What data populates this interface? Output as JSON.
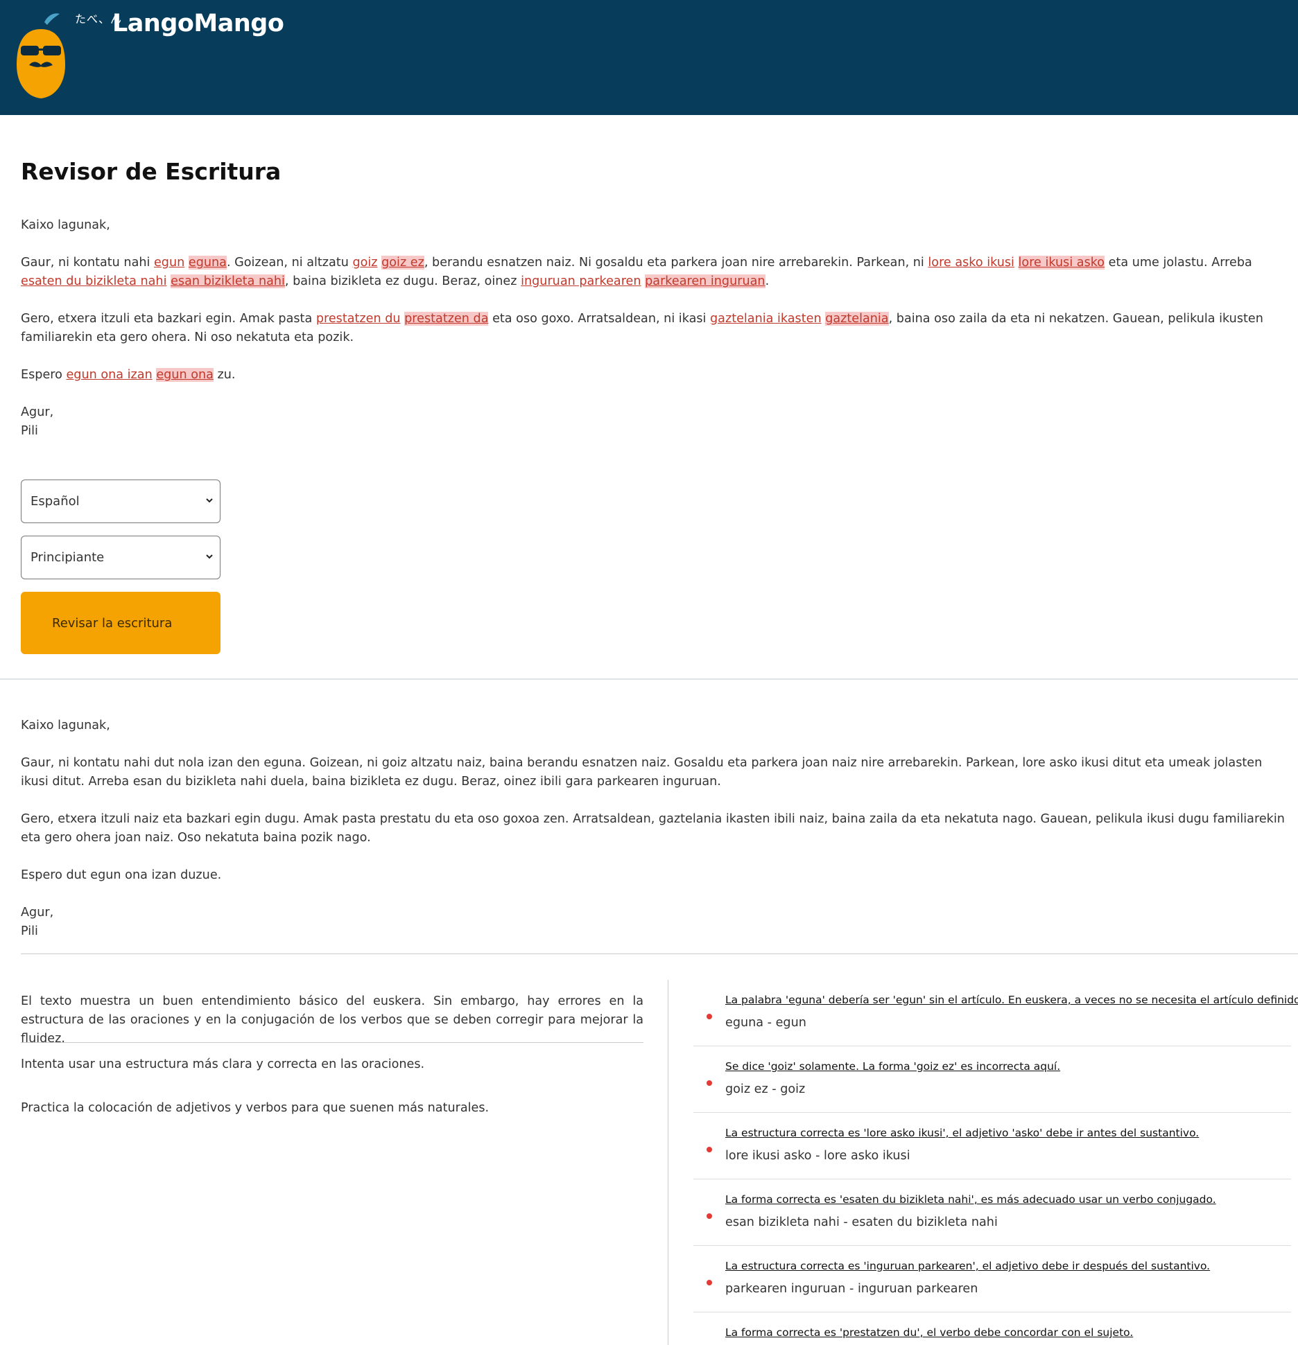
{
  "header": {
    "kanji": "たべ、ん",
    "brand": "LangoMango",
    "colors": {
      "background": "#073c5a",
      "mango": "#f5a203"
    }
  },
  "page_title": "Revisor de Escritura",
  "original_text": {
    "greeting": "Kaixo lagunak,",
    "p1": [
      {
        "t": "Gaur, ni kontatu nahi ",
        "s": "n"
      },
      {
        "t": "egun",
        "s": "e"
      },
      {
        "t": " ",
        "s": "n"
      },
      {
        "t": "eguna",
        "s": "h"
      },
      {
        "t": ". Goizean, ni altzatu ",
        "s": "n"
      },
      {
        "t": "goiz",
        "s": "e"
      },
      {
        "t": " ",
        "s": "n"
      },
      {
        "t": "goiz ez",
        "s": "h"
      },
      {
        "t": ", berandu esnatzen naiz. Ni gosaldu eta parkera joan nire arrebarekin. Parkean, ni ",
        "s": "n"
      },
      {
        "t": "lore asko ikusi",
        "s": "e"
      },
      {
        "t": " ",
        "s": "n"
      },
      {
        "t": "lore ikusi asko",
        "s": "h"
      },
      {
        "t": " eta ume jolastu. Arreba ",
        "s": "n"
      },
      {
        "t": "esaten du bizikleta nahi",
        "s": "e"
      },
      {
        "t": " ",
        "s": "n"
      },
      {
        "t": "esan bizikleta nahi",
        "s": "h"
      },
      {
        "t": ", baina bizikleta ez dugu. Beraz, oinez ",
        "s": "n"
      },
      {
        "t": "inguruan parkearen",
        "s": "e"
      },
      {
        "t": " ",
        "s": "n"
      },
      {
        "t": "parkearen inguruan",
        "s": "h"
      },
      {
        "t": ".",
        "s": "n"
      }
    ],
    "p2": [
      {
        "t": "Gero, etxera itzuli eta bazkari egin. Amak pasta ",
        "s": "n"
      },
      {
        "t": "prestatzen du",
        "s": "e"
      },
      {
        "t": " ",
        "s": "n"
      },
      {
        "t": "prestatzen da",
        "s": "h"
      },
      {
        "t": " eta oso goxo. Arratsaldean, ni ikasi ",
        "s": "n"
      },
      {
        "t": "gaztelania ikasten",
        "s": "e"
      },
      {
        "t": " ",
        "s": "n"
      },
      {
        "t": "gaztelania",
        "s": "h"
      },
      {
        "t": ", baina oso zaila da eta ni nekatzen. Gauean, pelikula ikusten familiarekin eta gero ohera. Ni oso nekatuta eta pozik.",
        "s": "n"
      }
    ],
    "p3": [
      {
        "t": "Espero ",
        "s": "n"
      },
      {
        "t": "egun ona izan",
        "s": "e"
      },
      {
        "t": " ",
        "s": "n"
      },
      {
        "t": "egun ona",
        "s": "h"
      },
      {
        "t": " zu.",
        "s": "n"
      }
    ],
    "closing": "Agur,",
    "signature": "Pili"
  },
  "controls": {
    "language_selected": "Español",
    "level_selected": "Principiante",
    "check_button": "Revisar la escritura"
  },
  "corrected_text": {
    "greeting": "Kaixo lagunak,",
    "p1": "Gaur, ni kontatu nahi dut nola izan den eguna. Goizean, ni goiz altzatu naiz, baina berandu esnatzen naiz. Gosaldu eta parkera joan naiz nire arrebarekin. Parkean, lore asko ikusi ditut eta umeak jolasten ikusi ditut. Arreba esan du bizikleta nahi duela, baina bizikleta ez dugu. Beraz, oinez ibili gara parkearen inguruan.",
    "p2": "Gero, etxera itzuli naiz eta bazkari egin dugu. Amak pasta prestatu du eta oso goxoa zen. Arratsaldean, gaztelania ikasten ibili naiz, baina zaila da eta nekatuta nago. Gauean, pelikula ikusi dugu familiarekin eta gero ohera joan naiz. Oso nekatuta baina pozik nago.",
    "p3": "Espero dut egun ona izan duzue.",
    "closing": "Agur,",
    "signature": "Pili"
  },
  "feedback": {
    "summary": "El texto muestra un buen entendimiento básico del euskera. Sin embargo, hay errores en la estructura de las oraciones y en la conjugación de los verbos que se deben corregir para mejorar la fluidez.",
    "tips": [
      "Intenta usar una estructura más clara y correcta en las oraciones.",
      "Practica la colocación de adjetivos y verbos para que suenen más naturales."
    ]
  },
  "corrections": [
    {
      "explanation": "La palabra 'eguna' debería ser 'egun' sin el artículo. En euskera, a veces no se necesita el artículo definido.",
      "pair": "eguna - egun"
    },
    {
      "explanation": "Se dice 'goiz' solamente. La forma 'goiz ez' es incorrecta aquí.",
      "pair": "goiz ez - goiz"
    },
    {
      "explanation": "La estructura correcta es 'lore asko ikusi', el adjetivo 'asko' debe ir antes del sustantivo.",
      "pair": "lore ikusi asko - lore asko ikusi"
    },
    {
      "explanation": "La forma correcta es 'esaten du bizikleta nahi', es más adecuado usar un verbo conjugado.",
      "pair": "esan bizikleta nahi - esaten du bizikleta nahi"
    },
    {
      "explanation": "La estructura correcta es 'inguruan parkearen', el adjetivo debe ir después del sustantivo.",
      "pair": "parkearen inguruan - inguruan parkearen"
    },
    {
      "explanation": "La forma correcta es 'prestatzen du', el verbo debe concordar con el sujeto.",
      "pair": ""
    }
  ]
}
